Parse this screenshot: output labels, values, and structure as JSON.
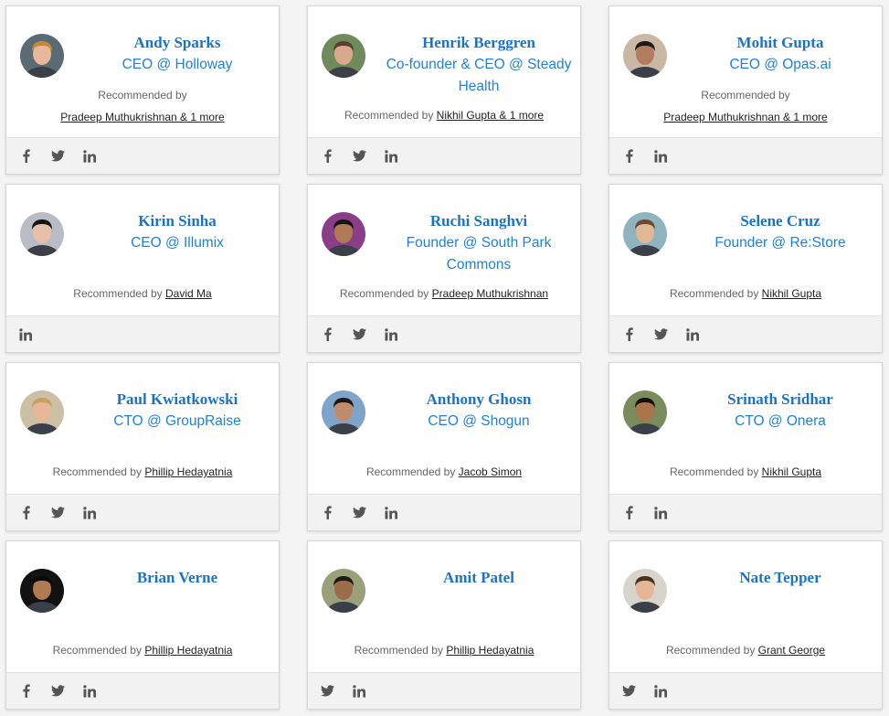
{
  "recommended_prefix": "Recommended by",
  "cards": [
    {
      "name": "Andy Sparks",
      "title": "CEO @ Holloway",
      "recommender": "Pradeep Muthukrishnan & 1 more",
      "stacked": true,
      "socials": [
        "facebook-icon",
        "twitter-icon",
        "linkedin-icon"
      ],
      "avatar": {
        "bg": "#5a6b74",
        "skin": "#e8b89a",
        "hair": "#c48a3a"
      }
    },
    {
      "name": "Henrik Berggren",
      "title": "Co-founder & CEO @ Steady Health",
      "recommender": "Nikhil Gupta & 1 more",
      "stacked": false,
      "socials": [
        "facebook-icon",
        "twitter-icon",
        "linkedin-icon"
      ],
      "avatar": {
        "bg": "#6f8a5c",
        "skin": "#d8a98c",
        "hair": "#5a4030"
      }
    },
    {
      "name": "Mohit Gupta",
      "title": "CEO @ Opas.ai",
      "recommender": "Pradeep Muthukrishnan & 1 more",
      "stacked": true,
      "socials": [
        "facebook-icon",
        "linkedin-icon"
      ],
      "avatar": {
        "bg": "#c9b8a4",
        "skin": "#b27d5e",
        "hair": "#1e1a18"
      }
    },
    {
      "name": "Kirin Sinha",
      "title": "CEO @ Illumix",
      "recommender": "David Ma",
      "stacked": false,
      "socials": [
        "linkedin-icon"
      ],
      "avatar": {
        "bg": "#b9bcc5",
        "skin": "#e6c0a8",
        "hair": "#14110f"
      }
    },
    {
      "name": "Ruchi Sanghvi",
      "title": "Founder @ South Park Commons",
      "recommender": "Pradeep Muthukrishnan",
      "stacked": false,
      "socials": [
        "facebook-icon",
        "twitter-icon",
        "linkedin-icon"
      ],
      "avatar": {
        "bg": "#8a3e88",
        "skin": "#b07a58",
        "hair": "#1a1410"
      }
    },
    {
      "name": "Selene Cruz",
      "title": "Founder @ Re:Store",
      "recommender": "Nikhil Gupta",
      "stacked": false,
      "socials": [
        "facebook-icon",
        "twitter-icon",
        "linkedin-icon"
      ],
      "avatar": {
        "bg": "#8fb4c0",
        "skin": "#e2b796",
        "hair": "#6b4a32"
      }
    },
    {
      "name": "Paul Kwiatkowski",
      "title": "CTO @ GroupRaise",
      "recommender": "Phillip Hedayatnia",
      "stacked": false,
      "socials": [
        "facebook-icon",
        "twitter-icon",
        "linkedin-icon"
      ],
      "avatar": {
        "bg": "#cbbfa6",
        "skin": "#e6b898",
        "hair": "#c9a060"
      }
    },
    {
      "name": "Anthony Ghosn",
      "title": "CEO @ Shogun",
      "recommender": "Jacob Simon",
      "stacked": false,
      "socials": [
        "facebook-icon",
        "twitter-icon",
        "linkedin-icon"
      ],
      "avatar": {
        "bg": "#7ea4c9",
        "skin": "#c08d6c",
        "hair": "#1c1612"
      }
    },
    {
      "name": "Srinath Sridhar",
      "title": "CTO @ Onera",
      "recommender": "Nikhil Gupta",
      "stacked": false,
      "socials": [
        "facebook-icon",
        "linkedin-icon"
      ],
      "avatar": {
        "bg": "#7a8c5c",
        "skin": "#a9744e",
        "hair": "#15110e"
      }
    },
    {
      "name": "Brian Verne",
      "title": "",
      "recommender": "Phillip Hedayatnia",
      "stacked": false,
      "socials": [
        "facebook-icon",
        "twitter-icon",
        "linkedin-icon"
      ],
      "avatar": {
        "bg": "#121212",
        "skin": "#b07a52",
        "hair": "#0c0a09"
      }
    },
    {
      "name": "Amit Patel",
      "title": "",
      "recommender": "Phillip Hedayatnia",
      "stacked": false,
      "socials": [
        "twitter-icon",
        "linkedin-icon"
      ],
      "avatar": {
        "bg": "#9aa07a",
        "skin": "#9c6c4c",
        "hair": "#1e1a16"
      }
    },
    {
      "name": "Nate Tepper",
      "title": "",
      "recommender": "Grant George",
      "stacked": false,
      "socials": [
        "twitter-icon",
        "linkedin-icon"
      ],
      "avatar": {
        "bg": "#d8d4cc",
        "skin": "#e4b696",
        "hair": "#4a3220"
      }
    }
  ],
  "colors": {
    "name": "#1a73c9",
    "title": "#1f80e0",
    "icon": "#555555",
    "footer": "#f2f2f2"
  }
}
